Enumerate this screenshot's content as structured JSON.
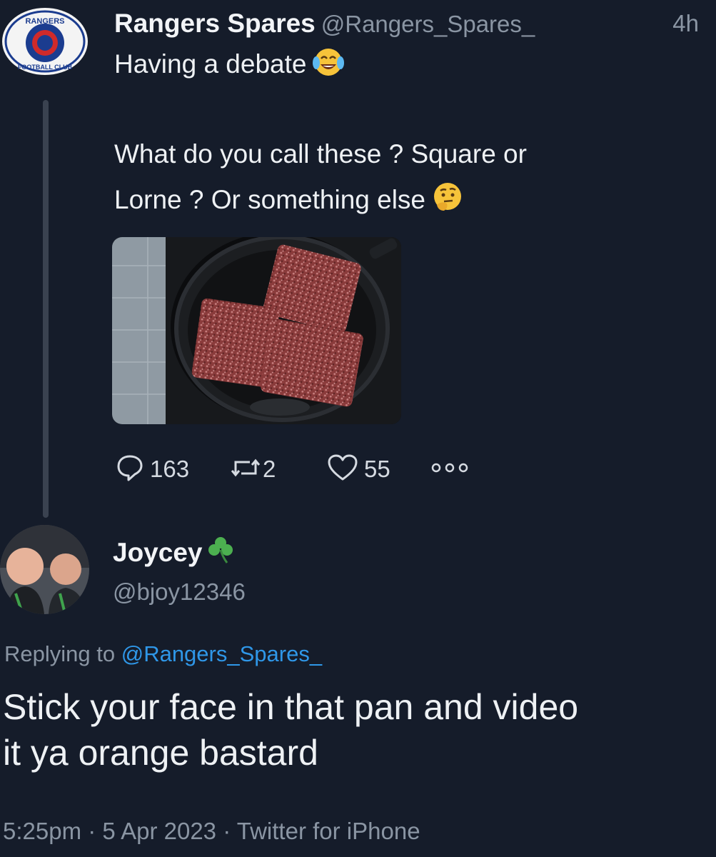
{
  "tweet": {
    "display_name": "Rangers Spares",
    "handle": "@Rangers_Spares_",
    "time": "4h",
    "avatar_text_top": "RANGERS",
    "avatar_text_bottom": "FOOTBALL CLUB",
    "line1": "Having a debate",
    "line1_emoji": "laughing-tears-emoji",
    "line2": "What do you call these ? Square or",
    "line3": "Lorne ? Or something else",
    "line3_emoji": "thinking-face-emoji",
    "stats": {
      "replies": "163",
      "retweets": "2",
      "likes": "55"
    }
  },
  "reply": {
    "display_name": "Joycey",
    "name_emoji": "shamrock-emoji",
    "handle": "@bjoy12346",
    "replying_prefix": "Replying to",
    "replying_mention": "@Rangers_Spares_",
    "line1": "Stick your face in that pan and video",
    "line2": "it ya orange bastard",
    "meta": "5:25pm · 5 Apr 2023 · Twitter for iPhone"
  },
  "colors": {
    "background": "#151c2a",
    "secondary_text": "#8a95a3",
    "link": "#2f97e8",
    "shamrock": "#4caf50"
  }
}
